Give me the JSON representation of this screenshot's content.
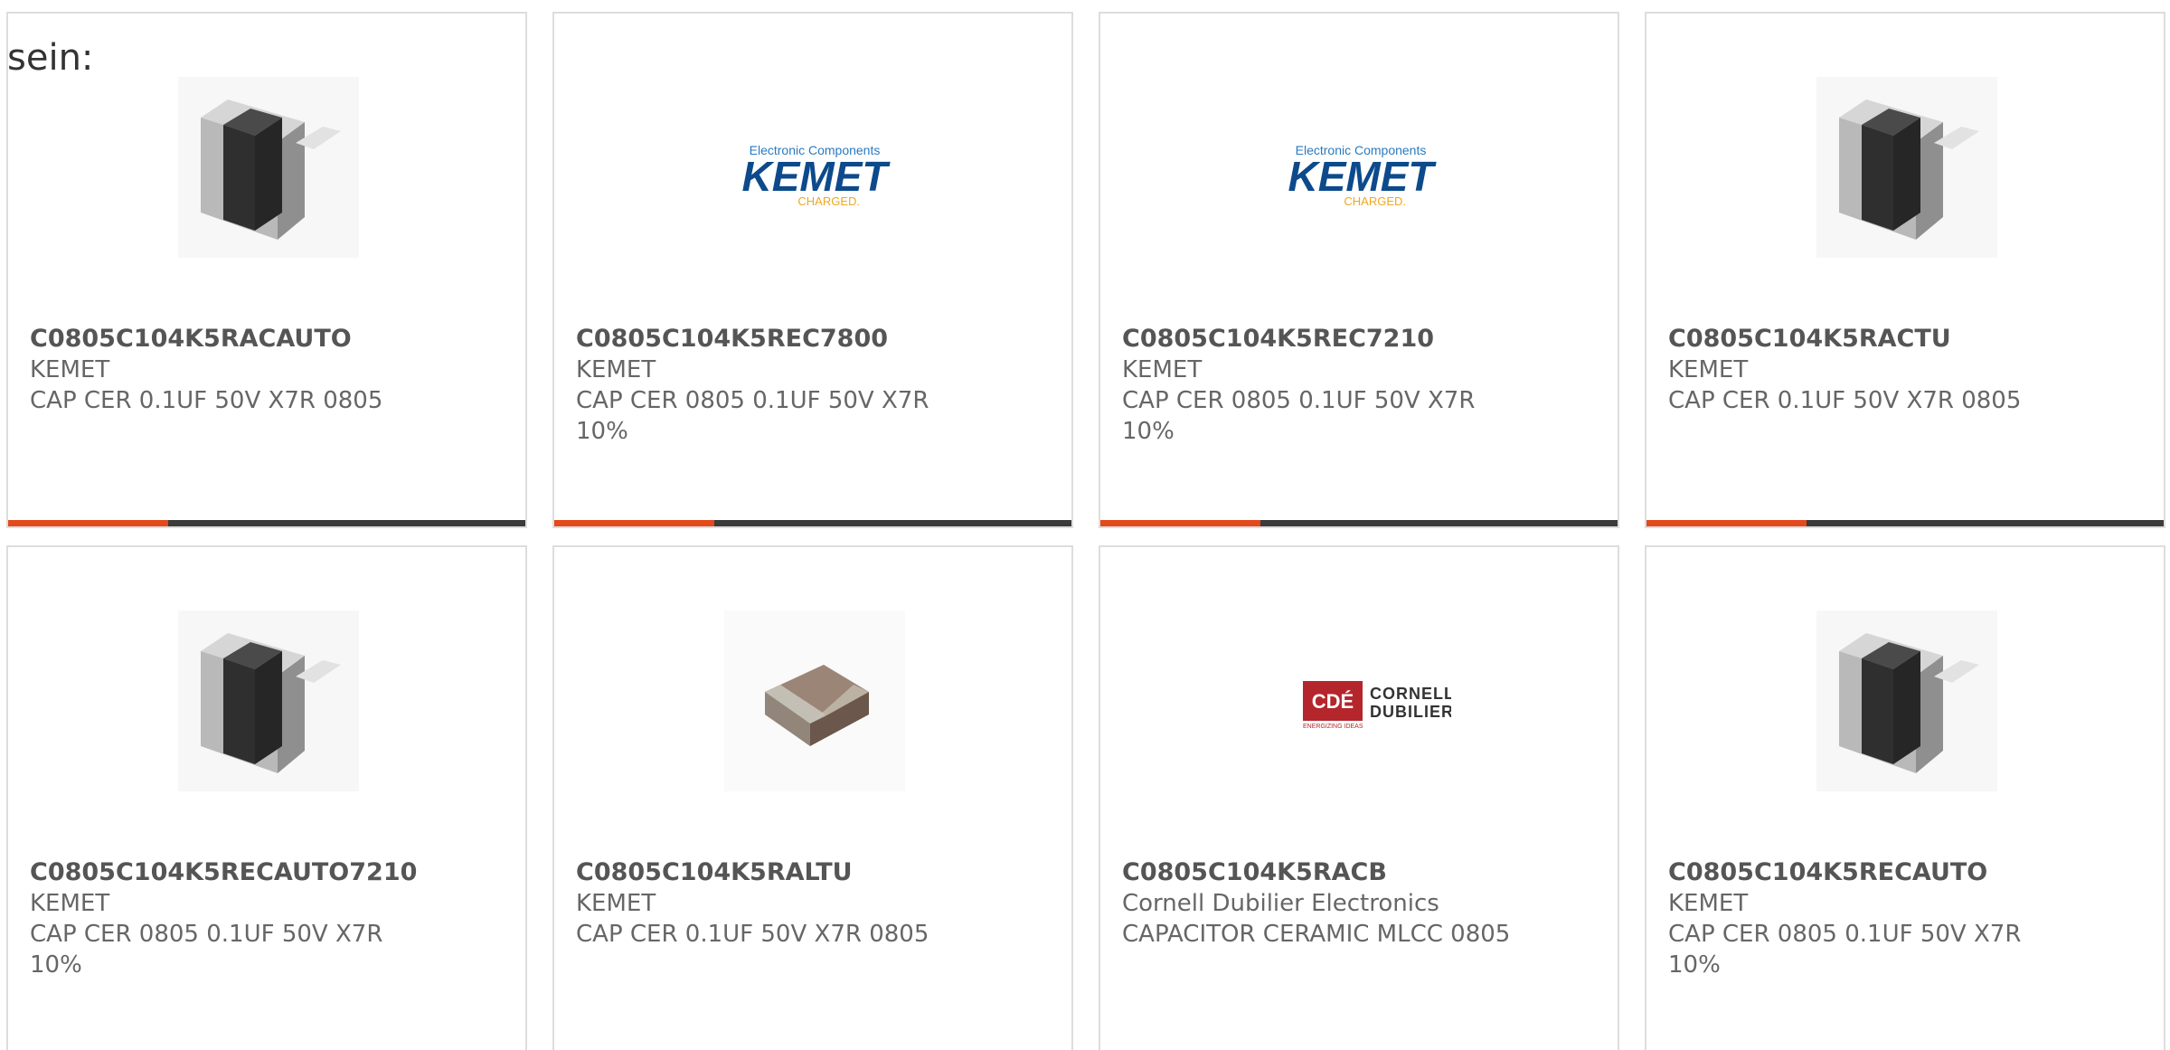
{
  "intro_text": "sein:",
  "accent_color": "#e34a1c",
  "bar_color": "#3b3b3b",
  "cards": [
    {
      "part_number": "C0805C104K5RACAUTO",
      "manufacturer": "KEMET",
      "description": "CAP CER 0.1UF 50V X7R 0805",
      "image_type": "capacitor-chip-dark-image",
      "progress_fraction": 0.31
    },
    {
      "part_number": "C0805C104K5REC7800",
      "manufacturer": "KEMET",
      "description": "CAP CER 0805 0.1UF 50V X7R 10%",
      "image_type": "kemet-logo",
      "logo_top": "Electronic Components",
      "logo_main": "KEMET",
      "logo_sub": "CHARGED.",
      "progress_fraction": 0.31
    },
    {
      "part_number": "C0805C104K5REC7210",
      "manufacturer": "KEMET",
      "description": "CAP CER 0805 0.1UF 50V X7R 10%",
      "image_type": "kemet-logo",
      "logo_top": "Electronic Components",
      "logo_main": "KEMET",
      "logo_sub": "CHARGED.",
      "progress_fraction": 0.31
    },
    {
      "part_number": "C0805C104K5RACTU",
      "manufacturer": "KEMET",
      "description": "CAP CER 0.1UF 50V X7R 0805",
      "image_type": "capacitor-chip-dark-image",
      "progress_fraction": 0.31
    },
    {
      "part_number": "C0805C104K5RECAUTO7210",
      "manufacturer": "KEMET",
      "description": "CAP CER 0805 0.1UF 50V X7R 10%",
      "image_type": "capacitor-chip-dark-image"
    },
    {
      "part_number": "C0805C104K5RALTU",
      "manufacturer": "KEMET",
      "description": "CAP CER 0.1UF 50V X7R 0805",
      "image_type": "capacitor-chip-brown-image"
    },
    {
      "part_number": "C0805C104K5RACB",
      "manufacturer": "Cornell Dubilier Electronics",
      "description": "CAPACITOR CERAMIC MLCC 0805",
      "image_type": "cde-logo",
      "logo_mark": "CDÉ",
      "logo_line1": "CORNELL",
      "logo_line2": "DUBILIER",
      "logo_tag": "ENERGIZING IDEAS"
    },
    {
      "part_number": "C0805C104K5RECAUTO",
      "manufacturer": "KEMET",
      "description": "CAP CER 0805 0.1UF 50V X7R 10%",
      "image_type": "capacitor-chip-dark-image"
    }
  ]
}
